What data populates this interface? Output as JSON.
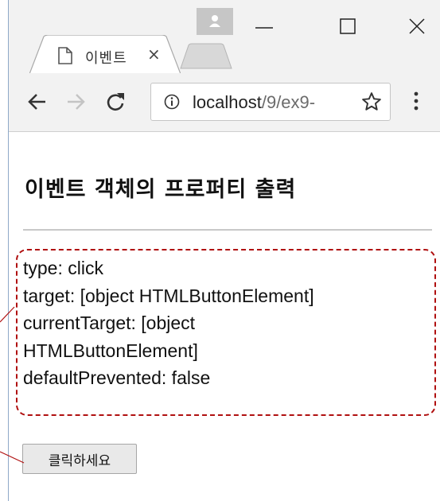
{
  "browser": {
    "tab": {
      "title": "이벤트",
      "close_glyph": "×"
    },
    "address": {
      "host": "localhost",
      "path": "/9/ex9-"
    },
    "window_controls": [
      "minimize",
      "maximize",
      "close"
    ],
    "colors": {
      "chrome": "#f2f2f2",
      "profile": "#c6c6c6"
    }
  },
  "page": {
    "title": "이벤트 객체의 프로퍼티 출력",
    "properties": [
      "type: click",
      "target: [object HTMLButtonElement]",
      "currentTarget: [object",
      "HTMLButtonElement]",
      "defaultPrevented: false"
    ],
    "button_label": "클릭하세요",
    "colors": {
      "annotation": "#b01010"
    }
  }
}
